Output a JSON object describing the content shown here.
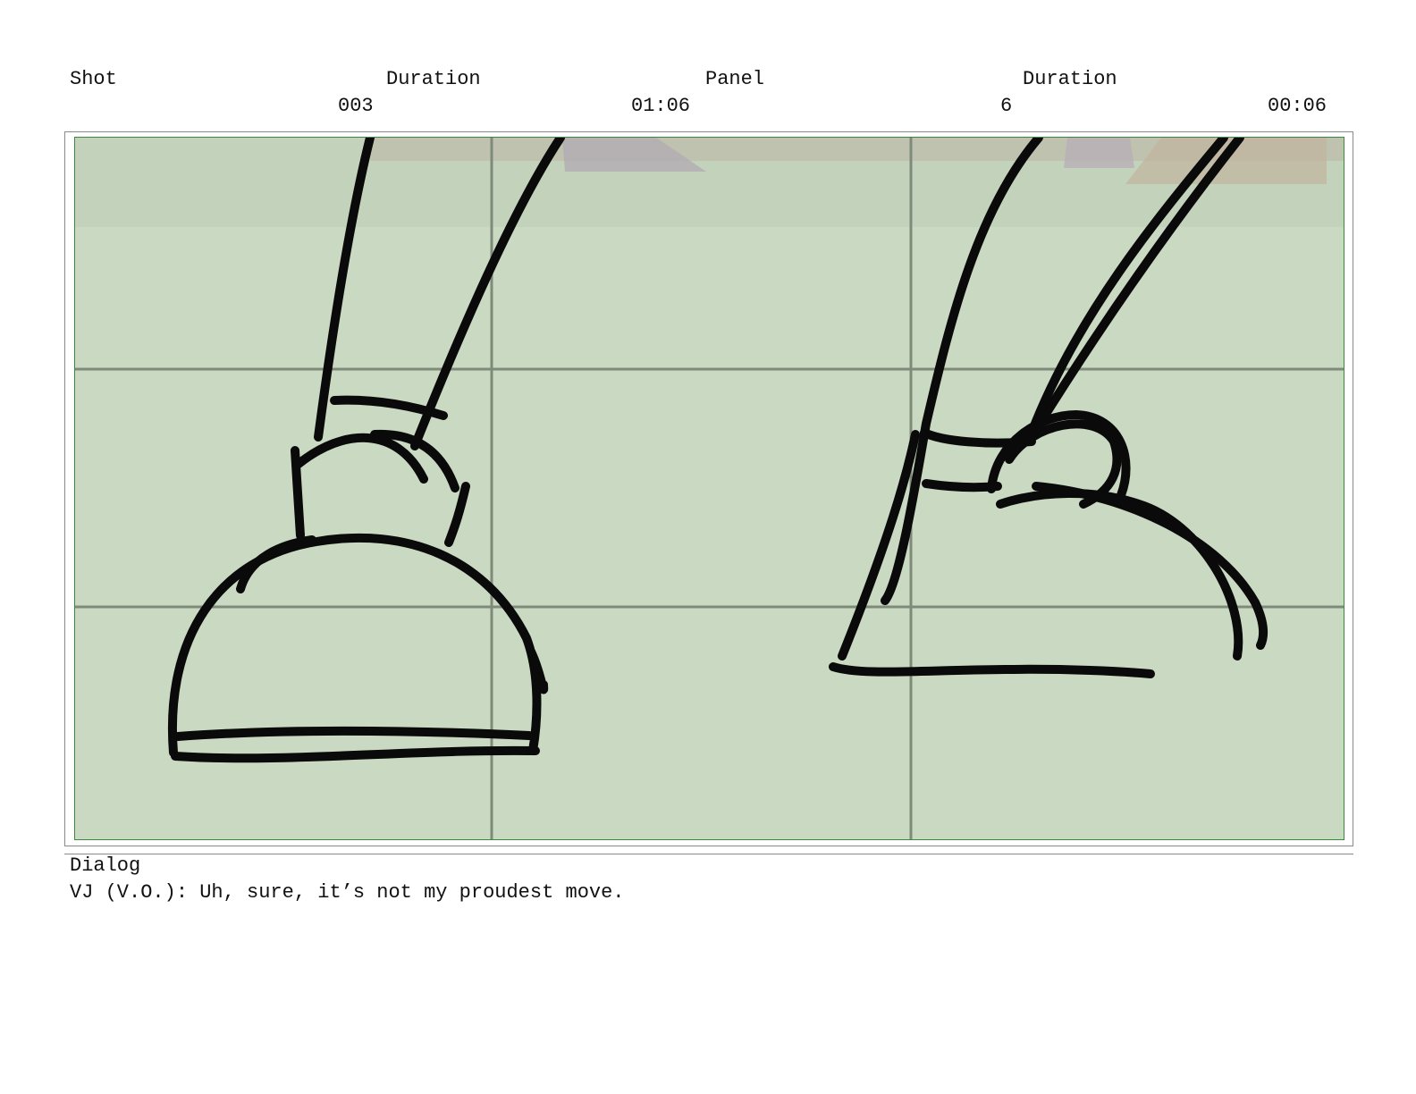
{
  "header": {
    "shot_label": "Shot",
    "shot_duration_label": "Duration",
    "panel_label": "Panel",
    "panel_duration_label": "Duration",
    "shot_value": "003",
    "shot_duration_value": "01:06",
    "panel_value": "6",
    "panel_duration_value": "00:06"
  },
  "panel_image": {
    "background_color": "#cad9c2",
    "grid_color": "#7f8a7b",
    "ink_color": "#0a0a0a"
  },
  "dialog": {
    "label": "Dialog",
    "text": "VJ (V.O.): Uh, sure, it’s not my proudest move."
  }
}
